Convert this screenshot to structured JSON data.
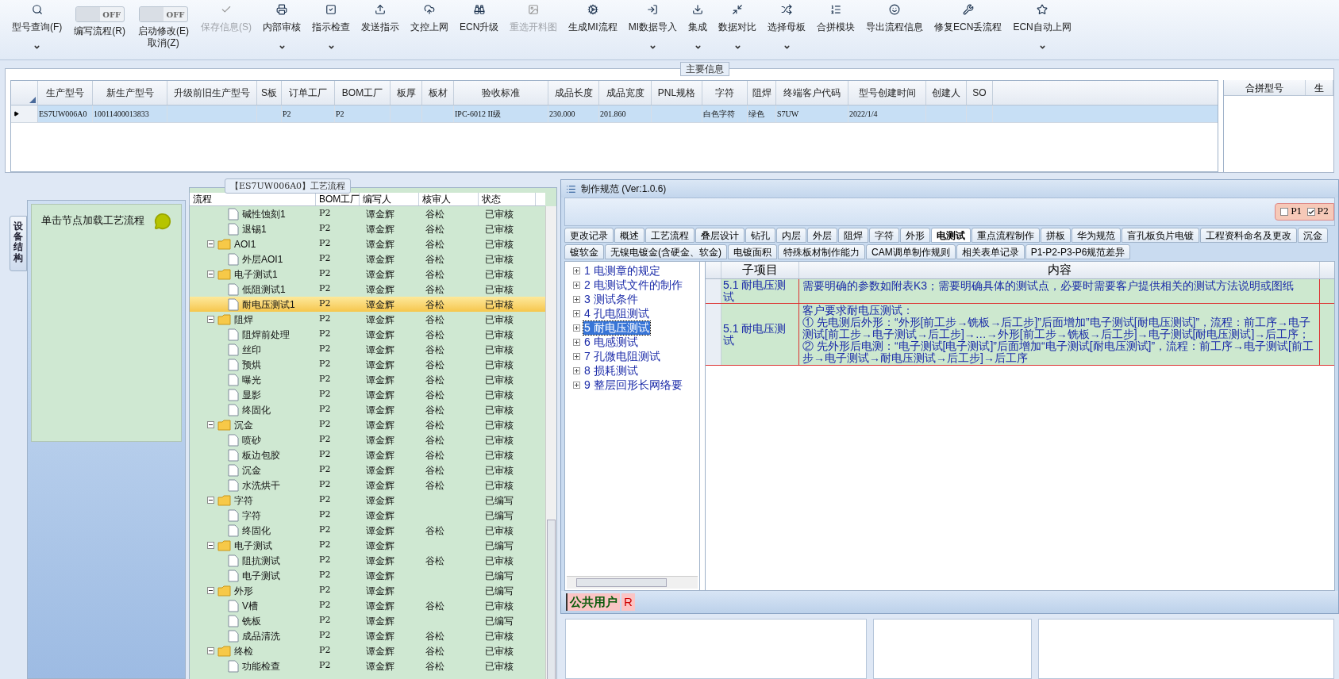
{
  "toolbar": [
    {
      "label": "型号查询(F)",
      "kind": "button",
      "disabled": false,
      "has_menu": true
    },
    {
      "label": "编写流程(R)",
      "kind": "toggle",
      "on": false,
      "state_text": "OFF"
    },
    {
      "label": "启动修改(E)",
      "sublabel": "取消(Z)",
      "kind": "toggle",
      "on": false,
      "state_text": "OFF"
    },
    {
      "label": "保存信息(S)",
      "kind": "button",
      "disabled": true,
      "has_menu": false
    },
    {
      "label": "内部审核",
      "kind": "button",
      "disabled": false,
      "has_menu": true
    },
    {
      "label": "指示检查",
      "kind": "button",
      "disabled": false,
      "has_menu": true
    },
    {
      "label": "发送指示",
      "kind": "button",
      "disabled": false,
      "has_menu": false
    },
    {
      "label": "文控上网",
      "kind": "button",
      "disabled": false,
      "has_menu": false
    },
    {
      "label": "ECN升级",
      "kind": "button",
      "disabled": false,
      "has_menu": false
    },
    {
      "label": "重选开料图",
      "kind": "button",
      "disabled": true,
      "has_menu": false
    },
    {
      "label": "生成MI流程",
      "kind": "button",
      "disabled": false,
      "has_menu": false
    },
    {
      "label": "MI数据导入",
      "kind": "button",
      "disabled": false,
      "has_menu": true
    },
    {
      "label": "集成",
      "kind": "button",
      "disabled": false,
      "has_menu": true
    },
    {
      "label": "数据对比",
      "kind": "button",
      "disabled": false,
      "has_menu": true
    },
    {
      "label": "选择母板",
      "kind": "button",
      "disabled": false,
      "has_menu": true
    },
    {
      "label": "合拼模块",
      "kind": "button",
      "disabled": false,
      "has_menu": false
    },
    {
      "label": "导出流程信息",
      "kind": "button",
      "disabled": false,
      "has_menu": false
    },
    {
      "label": "修复ECN丢流程",
      "kind": "button",
      "disabled": false,
      "has_menu": false
    },
    {
      "label": "ECN自动上网",
      "kind": "button",
      "disabled": false,
      "has_menu": true
    }
  ],
  "main_info": {
    "title": "主要信息",
    "columns": [
      "生产型号",
      "新生产型号",
      "升级前旧生产型号",
      "S板",
      "订单工厂",
      "BOM工厂",
      "板厚",
      "板材",
      "验收标准",
      "成品长度",
      "成品宽度",
      "PNL规格",
      "字符",
      "阻焊",
      "终端客户代码",
      "型号创建时间",
      "创建人",
      "SO"
    ],
    "rows": [
      {
        "selected": true,
        "cells": [
          "ES7UW006A0",
          "10011400013833",
          null,
          null,
          "P2",
          "P2",
          null,
          null,
          "IPC-6012 II级",
          "230.000",
          "201.860",
          null,
          "白色字符",
          "绿色",
          "S7UW",
          "2022/1/4",
          null,
          null
        ]
      }
    ],
    "side_columns": [
      "合拼型号",
      "生"
    ]
  },
  "side_panel": {
    "tab": "设备结构",
    "hint": "单击节点加载工艺流程"
  },
  "process": {
    "title": "【ES7UW006A0】工艺流程",
    "columns": [
      "流程",
      "BOM工厂",
      "编写人",
      "核审人",
      "状态"
    ],
    "nodes": [
      {
        "kind": "file",
        "name": "碱性蚀刻1",
        "factory": "P2",
        "writer": "谭金辉",
        "reviewer": "谷松",
        "status": "已审核",
        "selected": false
      },
      {
        "kind": "file",
        "name": "退锡1",
        "factory": "P2",
        "writer": "谭金辉",
        "reviewer": "谷松",
        "status": "已审核",
        "selected": false
      },
      {
        "kind": "folder",
        "name": "AOI1",
        "factory": "P2",
        "writer": "谭金辉",
        "reviewer": "谷松",
        "status": "已审核",
        "selected": false,
        "expanded": true,
        "children": [
          {
            "kind": "file",
            "name": "外层AOI1",
            "factory": "P2",
            "writer": "谭金辉",
            "reviewer": "谷松",
            "status": "已审核",
            "selected": false
          }
        ]
      },
      {
        "kind": "folder",
        "name": "电子测试1",
        "factory": "P2",
        "writer": "谭金辉",
        "reviewer": "谷松",
        "status": "已审核",
        "selected": false,
        "expanded": true,
        "children": [
          {
            "kind": "file",
            "name": "低阻测试1",
            "factory": "P2",
            "writer": "谭金辉",
            "reviewer": "谷松",
            "status": "已审核",
            "selected": false
          },
          {
            "kind": "file",
            "name": "耐电压测试1",
            "factory": "P2",
            "writer": "谭金辉",
            "reviewer": "谷松",
            "status": "已审核",
            "selected": true
          }
        ]
      },
      {
        "kind": "folder",
        "name": "阻焊",
        "factory": "P2",
        "writer": "谭金辉",
        "reviewer": "谷松",
        "status": "已审核",
        "selected": false,
        "expanded": true,
        "children": [
          {
            "kind": "file",
            "name": "阻焊前处理",
            "factory": "P2",
            "writer": "谭金辉",
            "reviewer": "谷松",
            "status": "已审核",
            "selected": false
          },
          {
            "kind": "file",
            "name": "丝印",
            "factory": "P2",
            "writer": "谭金辉",
            "reviewer": "谷松",
            "status": "已审核",
            "selected": false
          },
          {
            "kind": "file",
            "name": "预烘",
            "factory": "P2",
            "writer": "谭金辉",
            "reviewer": "谷松",
            "status": "已审核",
            "selected": false
          },
          {
            "kind": "file",
            "name": "曝光",
            "factory": "P2",
            "writer": "谭金辉",
            "reviewer": "谷松",
            "status": "已审核",
            "selected": false
          },
          {
            "kind": "file",
            "name": "显影",
            "factory": "P2",
            "writer": "谭金辉",
            "reviewer": "谷松",
            "status": "已审核",
            "selected": false
          },
          {
            "kind": "file",
            "name": "终固化",
            "factory": "P2",
            "writer": "谭金辉",
            "reviewer": "谷松",
            "status": "已审核",
            "selected": false
          }
        ]
      },
      {
        "kind": "folder",
        "name": "沉金",
        "factory": "P2",
        "writer": "谭金辉",
        "reviewer": "谷松",
        "status": "已审核",
        "selected": false,
        "expanded": true,
        "children": [
          {
            "kind": "file",
            "name": "喷砂",
            "factory": "P2",
            "writer": "谭金辉",
            "reviewer": "谷松",
            "status": "已审核",
            "selected": false
          },
          {
            "kind": "file",
            "name": "板边包胶",
            "factory": "P2",
            "writer": "谭金辉",
            "reviewer": "谷松",
            "status": "已审核",
            "selected": false
          },
          {
            "kind": "file",
            "name": "沉金",
            "factory": "P2",
            "writer": "谭金辉",
            "reviewer": "谷松",
            "status": "已审核",
            "selected": false
          },
          {
            "kind": "file",
            "name": "水洗烘干",
            "factory": "P2",
            "writer": "谭金辉",
            "reviewer": "谷松",
            "status": "已审核",
            "selected": false
          }
        ]
      },
      {
        "kind": "folder",
        "name": "字符",
        "factory": "P2",
        "writer": "谭金辉",
        "status": "已编写",
        "selected": false,
        "expanded": true,
        "children": [
          {
            "kind": "file",
            "name": "字符",
            "factory": "P2",
            "writer": "谭金辉",
            "status": "已编写",
            "selected": false
          },
          {
            "kind": "file",
            "name": "终固化",
            "factory": "P2",
            "writer": "谭金辉",
            "reviewer": "谷松",
            "status": "已审核",
            "selected": false
          }
        ]
      },
      {
        "kind": "folder",
        "name": "电子测试",
        "factory": "P2",
        "writer": "谭金辉",
        "status": "已编写",
        "selected": false,
        "expanded": true,
        "children": [
          {
            "kind": "file",
            "name": "阻抗测试",
            "factory": "P2",
            "writer": "谭金辉",
            "reviewer": "谷松",
            "status": "已审核",
            "selected": false
          },
          {
            "kind": "file",
            "name": "电子测试",
            "factory": "P2",
            "writer": "谭金辉",
            "status": "已编写",
            "selected": false
          }
        ]
      },
      {
        "kind": "folder",
        "name": "外形",
        "factory": "P2",
        "writer": "谭金辉",
        "status": "已编写",
        "selected": false,
        "expanded": true,
        "children": [
          {
            "kind": "file",
            "name": "V槽",
            "factory": "P2",
            "writer": "谭金辉",
            "reviewer": "谷松",
            "status": "已审核",
            "selected": false
          },
          {
            "kind": "file",
            "name": "铣板",
            "factory": "P2",
            "writer": "谭金辉",
            "status": "已编写",
            "selected": false
          },
          {
            "kind": "file",
            "name": "成品清洗",
            "factory": "P2",
            "writer": "谭金辉",
            "reviewer": "谷松",
            "status": "已审核",
            "selected": false
          }
        ]
      },
      {
        "kind": "folder",
        "name": "终检",
        "factory": "P2",
        "writer": "谭金辉",
        "reviewer": "谷松",
        "status": "已审核",
        "selected": false,
        "expanded": true,
        "children": [
          {
            "kind": "file",
            "name": "功能检查",
            "factory": "P2",
            "writer": "谭金辉",
            "reviewer": "谷松",
            "status": "已审核",
            "selected": false
          }
        ]
      }
    ]
  },
  "spec_window": {
    "title": "制作规范 (Ver:1.0.6)",
    "filters": [
      {
        "label": "P1",
        "checked": false
      },
      {
        "label": "P2",
        "checked": true
      }
    ],
    "tab_rows": [
      [
        {
          "label": "更改记录",
          "selected": false
        },
        {
          "label": "概述",
          "selected": false
        },
        {
          "label": "工艺流程",
          "selected": false
        },
        {
          "label": "叠层设计",
          "selected": false
        },
        {
          "label": "钻孔",
          "selected": false
        },
        {
          "label": "内层",
          "selected": false
        },
        {
          "label": "外层",
          "selected": false
        },
        {
          "label": "阻焊",
          "selected": false
        },
        {
          "label": "字符",
          "selected": false
        },
        {
          "label": "外形",
          "selected": false
        },
        {
          "label": "电测试",
          "selected": true
        },
        {
          "label": "重点流程制作",
          "selected": false
        },
        {
          "label": "拼板",
          "selected": false
        },
        {
          "label": "华为规范",
          "selected": false
        },
        {
          "label": "盲孔板负片电镀",
          "selected": false
        },
        {
          "label": "工程资料命名及更改",
          "selected": false
        },
        {
          "label": "沉金",
          "selected": false
        }
      ],
      [
        {
          "label": "镀软金",
          "selected": false
        },
        {
          "label": "无镍电镀金(含硬金、软金)",
          "selected": false
        },
        {
          "label": "电镀面积",
          "selected": false
        },
        {
          "label": "特殊板材制作能力",
          "selected": false
        },
        {
          "label": "CAM调单制作规则",
          "selected": false
        },
        {
          "label": "相关表单记录",
          "selected": false
        },
        {
          "label": "P1-P2-P3-P6规范差异",
          "selected": false
        }
      ]
    ],
    "outline": [
      {
        "label": "1 电测章的规定",
        "selected": false
      },
      {
        "label": "2 电测试文件的制作",
        "selected": false
      },
      {
        "label": "3 测试条件",
        "selected": false
      },
      {
        "label": "4 孔电阻测试",
        "selected": false
      },
      {
        "label": "5 耐电压测试",
        "selected": true
      },
      {
        "label": "6 电感测试",
        "selected": false
      },
      {
        "label": "7 孔微电阻测试",
        "selected": false
      },
      {
        "label": "8 损耗测试",
        "selected": false
      },
      {
        "label": "9 整层回形长网络要",
        "selected": false
      }
    ],
    "table": {
      "columns": [
        "子项目",
        "内容"
      ],
      "rows": [
        {
          "sub": "5.1 耐电压测试",
          "content": [
            "需要明确的参数如附表K3；需要明确具体的测试点，必要时需要客户提供相关的测试方法说明或图纸"
          ]
        },
        {
          "sub": "5.1 耐电压测试",
          "content": [
            "客户要求耐电压测试：",
            "① 先电测后外形：“外形[前工步→铣板→后工步]”后面增加”电子测试[耐电压测试]”，流程：前工序→电子测试[前工步→电子测试→后工步]→…→外形[前工步→铣板→后工步]→电子测试[耐电压测试]→后工序；",
            "② 先外形后电测：“电子测试[电子测试]”后面增加“电子测试[耐电压测试]”，流程：前工序→电子测试[前工步→电子测试→耐电压测试→后工步]→后工序"
          ]
        }
      ]
    },
    "status": {
      "user": "公共用户",
      "mode": "R"
    }
  }
}
